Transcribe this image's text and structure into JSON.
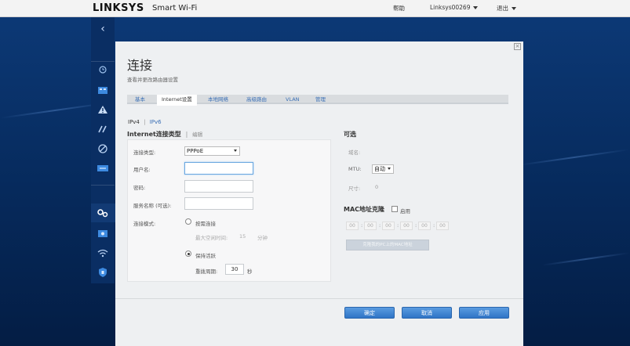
{
  "header": {
    "logo": "LINKSYS",
    "product": "Smart Wi-Fi",
    "help": "帮助",
    "router_name": "Linksys00269",
    "logout": "退出"
  },
  "sidebar": {
    "back_icon": "chevron-left-icon",
    "items": [
      "router-clock-icon",
      "network-map-icon",
      "warning-icon",
      "connectivity-icon",
      "parental-icon",
      "media-icon",
      "settings-gears-icon",
      "security-icon",
      "wifi-icon",
      "shield-icon"
    ]
  },
  "page": {
    "title": "连接",
    "subtitle": "查看并更改路由器设置"
  },
  "tabs": [
    {
      "label": "基本",
      "active": false
    },
    {
      "label": "Internet设置",
      "active": true
    },
    {
      "label": "本地网络",
      "active": false
    },
    {
      "label": "高级路由",
      "active": false
    },
    {
      "label": "VLAN",
      "active": false
    },
    {
      "label": "管理",
      "active": false
    }
  ],
  "ip_version": {
    "ipv4": "IPv4",
    "separator": "|",
    "ipv6": "IPv6"
  },
  "internet_type": {
    "title": "Internet连接类型",
    "separator": "|",
    "edit": "编辑",
    "connection_type_label": "连接类型:",
    "connection_type_value": "PPPoE",
    "username_label": "用户名:",
    "username_value": "",
    "password_label": "密码:",
    "password_value": "",
    "service_label": "服务名称 (可选):",
    "service_value": "",
    "mode_label": "连接模式:",
    "on_demand_label": "按需连接",
    "max_idle_label": "最大空闲时间:",
    "max_idle_value": "15",
    "max_idle_unit": "分钟",
    "keep_alive_label": "保持活跃",
    "redial_label": "重拨周期:",
    "redial_value": "30",
    "redial_unit": "秒"
  },
  "optional": {
    "title": "可选",
    "domain_label": "域名:",
    "mtu_label": "MTU:",
    "mtu_value": "自动",
    "size_label": "尺寸:",
    "size_value": "0",
    "mac_clone_title": "MAC地址克隆",
    "mac_enable_label": "启用",
    "mac_segments": [
      "00",
      "00",
      "00",
      "00",
      "00",
      "00"
    ],
    "clone_button": "克隆我的PC上的MAC地址"
  },
  "footer": {
    "ok": "确定",
    "cancel": "取消",
    "apply": "应用"
  },
  "colors": {
    "accent": "#2f74c6",
    "link": "#3a6fb5",
    "background": "#0d3a78"
  }
}
